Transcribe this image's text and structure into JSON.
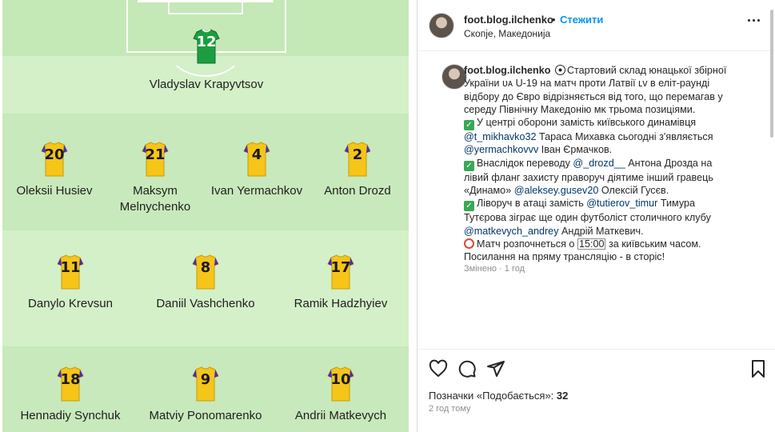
{
  "formation": {
    "goalkeeper": {
      "number": "12",
      "name": "Vladyslav Krapyvtsov"
    },
    "defenders": [
      {
        "number": "20",
        "name": "Oleksii Husiev"
      },
      {
        "number": "21",
        "name": "Maksym Melnychenko"
      },
      {
        "number": "4",
        "name": "Ivan Yermachkov"
      },
      {
        "number": "2",
        "name": "Anton Drozd"
      }
    ],
    "midfielders": [
      {
        "number": "11",
        "name": "Danylo Krevsun"
      },
      {
        "number": "8",
        "name": "Daniil Vashchenko"
      },
      {
        "number": "17",
        "name": "Ramik Hadzhyiev"
      }
    ],
    "forwards": [
      {
        "number": "18",
        "name": "Hennadiy Synchuk"
      },
      {
        "number": "9",
        "name": "Matviy Ponomarenko"
      },
      {
        "number": "10",
        "name": "Andrii Matkevych"
      }
    ],
    "colors": {
      "pitch_light": "#cfeec3",
      "pitch_dark": "#c2e6b4",
      "field_shirt": "#f5c518",
      "shirt_trim": "#4b2bb4",
      "gk_shirt": "#1c9e3f"
    }
  },
  "post": {
    "username": "foot.blog.ilchenko",
    "dot": "•",
    "follow_label": "Стежити",
    "location": "Скопје, Македонија",
    "caption": {
      "l1_text": "Стартовий склад юнацької збірної",
      "l2": "України ᴜᴀ U-19 на матч проти Латвії ʟᴠ в еліт-раунді",
      "l3": "відбору до Євро відрізняється від того, що перемагав у",
      "l4": "середу Північну Македонію ᴍᴋ трьома позиціями.",
      "l5": "У центрі оборони замість київського динамівця",
      "l6_link": "@t_mikhavko32",
      "l6_text": " Тараса Михавка сьогодні з'являється",
      "l7_link": "@yermachkovvv",
      "l7_text": " Іван Єрмачков.",
      "l8_text": "Внаслідок переводу ",
      "l8_link": "@_drozd__",
      "l8_text2": " Антона Дрозда на",
      "l9": "лівий фланг захисту праворуч діятиме інший гравець",
      "l10_text": "«Динамо» ",
      "l10_link": "@aleksey.gusev20",
      "l10_text2": " Олексій Гусєв.",
      "l11_text": "Ліворуч в атаці замість ",
      "l11_link": "@tutierov_timur",
      "l11_text2": " Тимура",
      "l12": "Тутєрова зіграє ще один футболіст столичного клубу",
      "l13_link": "@matkevych_andrey",
      "l13_text": " Андрій Маткевич.",
      "l14_text": "Матч розпочнеться о ",
      "l14_time": "15:00",
      "l14_text2": " за київським часом.",
      "l15": "Посилання на пряму трансляцію - в сторіс!"
    },
    "edited": "Змінено · 1 год",
    "likes_label": "Позначки «Подобається»: ",
    "likes_count": "32",
    "time_ago": "2 год тому"
  }
}
